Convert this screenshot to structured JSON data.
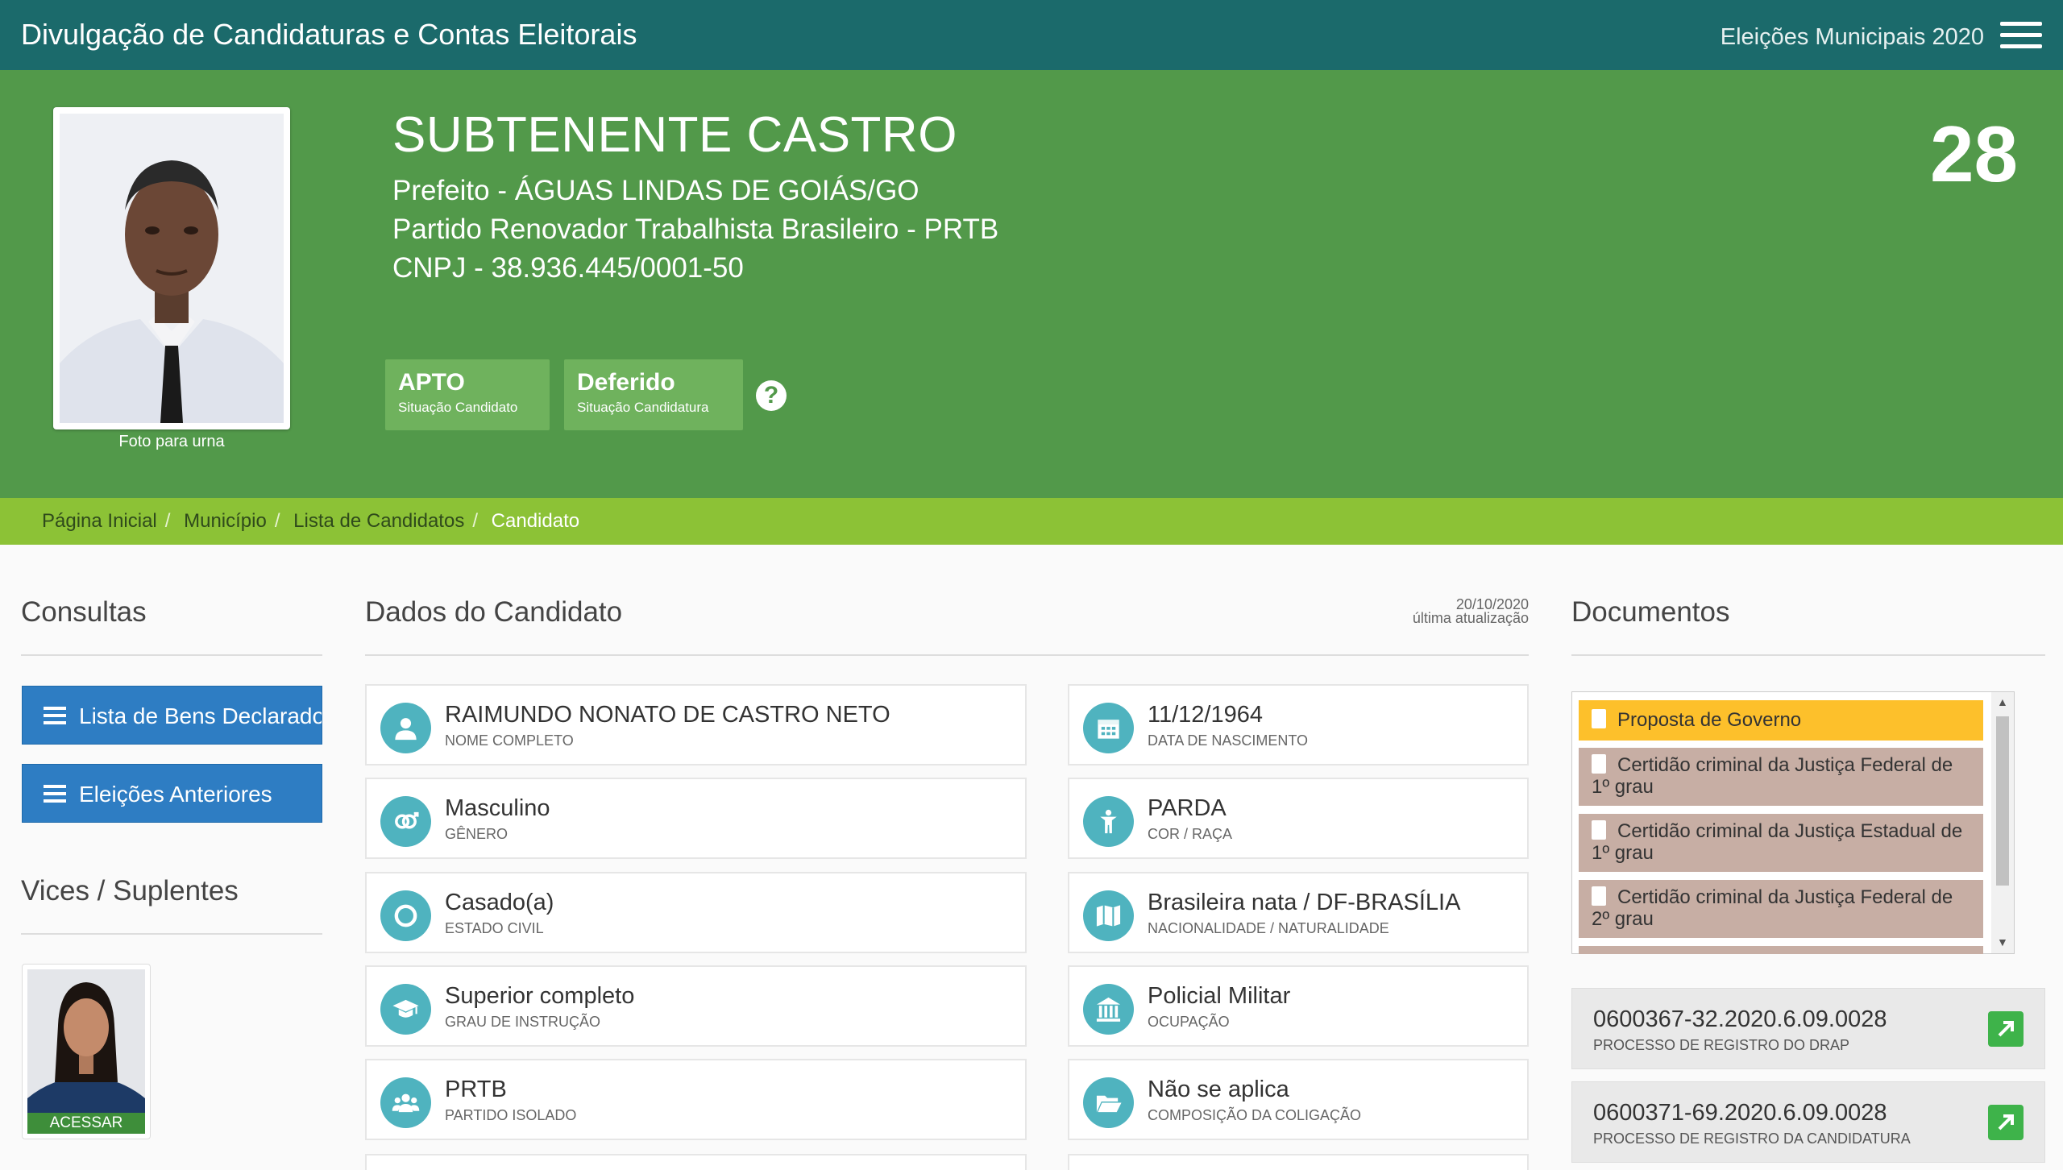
{
  "header": {
    "title": "Divulgação de Candidaturas e Contas Eleitorais",
    "election": "Eleições Municipais 2020",
    "menu_icon": "hamburger-menu-icon"
  },
  "candidate": {
    "name": "SUBTENENTE CASTRO",
    "office": "Prefeito - ÁGUAS LINDAS DE GOIÁS/GO",
    "party": "Partido Renovador Trabalhista Brasileiro - PRTB",
    "cnpj": "CNPJ - 38.936.445/0001-50",
    "number": "28",
    "photo_caption": "Foto para urna",
    "status": [
      {
        "value": "APTO",
        "label": "Situação Candidato"
      },
      {
        "value": "Deferido",
        "label": "Situação Candidatura"
      }
    ],
    "help": "?"
  },
  "breadcrumb": [
    "Página Inicial",
    "Município",
    "Lista de Candidatos",
    "Candidato"
  ],
  "consultas": {
    "title": "Consultas",
    "buttons": [
      "Lista de Bens Declarados",
      "Eleições Anteriores"
    ]
  },
  "vices": {
    "title": "Vices / Suplentes",
    "access_label": "ACESSAR"
  },
  "dados": {
    "title": "Dados do Candidato",
    "update_date": "20/10/2020",
    "update_label": "última atualização",
    "fields": [
      {
        "value": "RAIMUNDO NONATO DE CASTRO NETO",
        "label": "NOME COMPLETO",
        "icon": "person-icon"
      },
      {
        "value": "11/12/1964",
        "label": "DATA DE NASCIMENTO",
        "icon": "calendar-icon"
      },
      {
        "value": "Masculino",
        "label": "GÊNERO",
        "icon": "gender-icon"
      },
      {
        "value": "PARDA",
        "label": "COR / RAÇA",
        "icon": "figure-icon"
      },
      {
        "value": "Casado(a)",
        "label": "ESTADO CIVIL",
        "icon": "ring-icon"
      },
      {
        "value": "Brasileira nata / DF-BRASÍLIA",
        "label": "NACIONALIDADE / NATURALIDADE",
        "icon": "map-icon"
      },
      {
        "value": "Superior completo",
        "label": "GRAU DE INSTRUÇÃO",
        "icon": "graduation-cap-icon"
      },
      {
        "value": "Policial Militar",
        "label": "OCUPAÇÃO",
        "icon": "institution-icon"
      },
      {
        "value": "PRTB",
        "label": "PARTIDO ISOLADO",
        "icon": "group-icon"
      },
      {
        "value": "Não se aplica",
        "label": "COMPOSIÇÃO DA COLIGAÇÃO",
        "icon": "folder-open-icon"
      }
    ]
  },
  "documentos": {
    "title": "Documentos",
    "items": [
      "Proposta de Governo",
      "Certidão criminal da Justiça Federal de 1º grau",
      "Certidão criminal da Justiça Estadual de 1º grau",
      "Certidão criminal da Justiça Federal de 2º grau"
    ],
    "processes": [
      {
        "number": "0600367-32.2020.6.09.0028",
        "label": "PROCESSO DE REGISTRO DO DRAP"
      },
      {
        "number": "0600371-69.2020.6.09.0028",
        "label": "PROCESSO DE REGISTRO DA CANDIDATURA"
      }
    ]
  },
  "colors": {
    "header": "#1b6a6b",
    "hero": "#52994a",
    "breadcrumb": "#8cc236",
    "button": "#2e7dc3",
    "icon_circle": "#4fb3bf",
    "doc_highlight": "#fdc02b",
    "doc_item": "#c7aea4",
    "external_link": "#3eb34a"
  }
}
